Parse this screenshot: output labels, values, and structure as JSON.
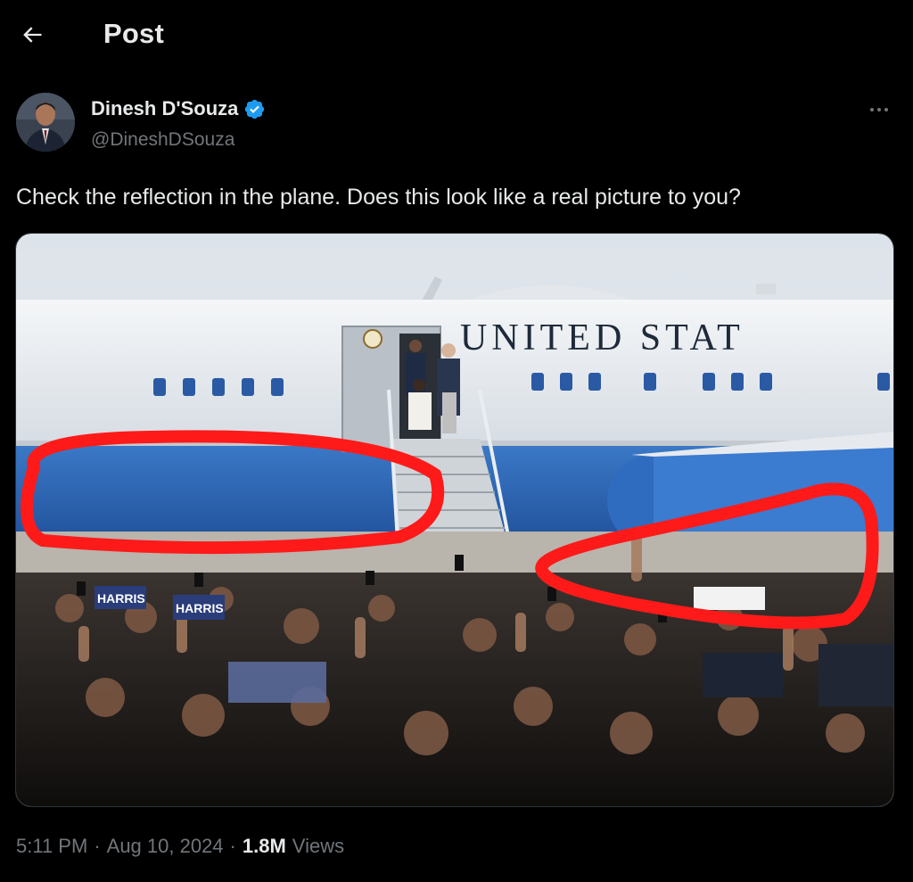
{
  "header": {
    "title": "Post",
    "back_icon": "arrow-left-icon"
  },
  "author": {
    "name": "Dinesh D'Souza",
    "handle": "@DineshDSouza",
    "verified_icon": "verified-badge-icon",
    "verified_color": "#1d9bf0"
  },
  "post": {
    "text": "Check the reflection in the plane. Does this look like a real picture to you?",
    "image": {
      "aircraft_lettering": "UNITED STAT",
      "annotation_color": "#ff1a1a",
      "sign_text_1": "HARRIS",
      "sign_text_2": "HARRIS"
    }
  },
  "meta": {
    "time": "5:11 PM",
    "separator": "·",
    "date": "Aug 10, 2024",
    "views_count": "1.8M",
    "views_label": "Views"
  },
  "colors": {
    "background": "#000000",
    "text_primary": "#e7e9ea",
    "text_secondary": "#71767b",
    "accent": "#1d9bf0"
  }
}
